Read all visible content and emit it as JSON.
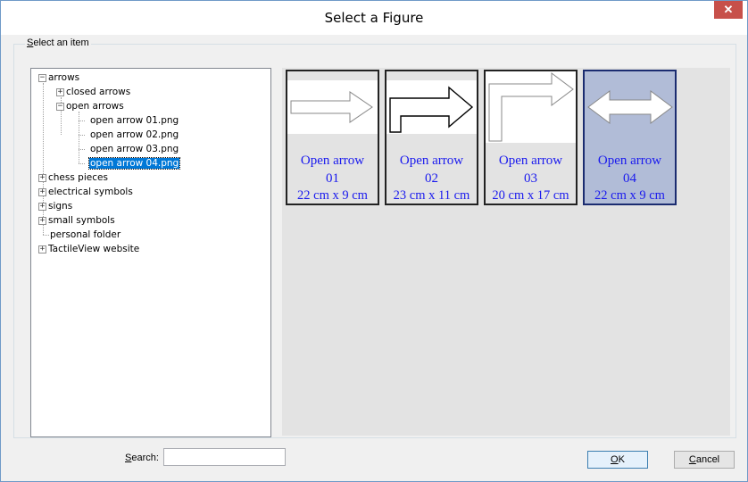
{
  "window": {
    "title": "Select a Figure",
    "close_glyph": "✕"
  },
  "group": {
    "label_accel": "S",
    "label_rest": "elect an item"
  },
  "tree": {
    "items": [
      {
        "label": "arrows",
        "expander": "−"
      },
      {
        "label": "closed arrows",
        "expander": "+"
      },
      {
        "label": "open arrows",
        "expander": "−"
      },
      {
        "label": "open arrow 01.png"
      },
      {
        "label": "open arrow 02.png"
      },
      {
        "label": "open arrow 03.png"
      },
      {
        "label": "open arrow 04.png",
        "selected": true
      },
      {
        "label": "chess pieces",
        "expander": "+"
      },
      {
        "label": "electrical symbols",
        "expander": "+"
      },
      {
        "label": "signs",
        "expander": "+"
      },
      {
        "label": "small symbols",
        "expander": "+"
      },
      {
        "label": "personal folder"
      },
      {
        "label": "TactileView website",
        "expander": "+"
      }
    ]
  },
  "thumbnails": [
    {
      "name": "Open arrow",
      "number": "01",
      "dims": "22 cm x 9 cm",
      "icon": "open-arrow-right-icon",
      "selected": false
    },
    {
      "name": "Open arrow",
      "number": "02",
      "dims": "23 cm x 11 cm",
      "icon": "bent-arrow-right-icon",
      "selected": false
    },
    {
      "name": "Open arrow",
      "number": "03",
      "dims": "20 cm x 17 cm",
      "icon": "bent-arrow-up-right-icon",
      "selected": false
    },
    {
      "name": "Open arrow",
      "number": "04",
      "dims": "22 cm x 9 cm",
      "icon": "double-arrow-icon",
      "selected": true
    }
  ],
  "search": {
    "label_accel": "S",
    "label_rest": "earch:",
    "value": "",
    "placeholder": ""
  },
  "buttons": {
    "ok_accel": "O",
    "ok_rest": "K",
    "cancel_accel": "C",
    "cancel_rest": "ancel"
  },
  "colors": {
    "selection": "#0078d7",
    "caption": "#1a1aee",
    "close": "#c7504a",
    "thumb_selected": "#b1bcd7"
  }
}
